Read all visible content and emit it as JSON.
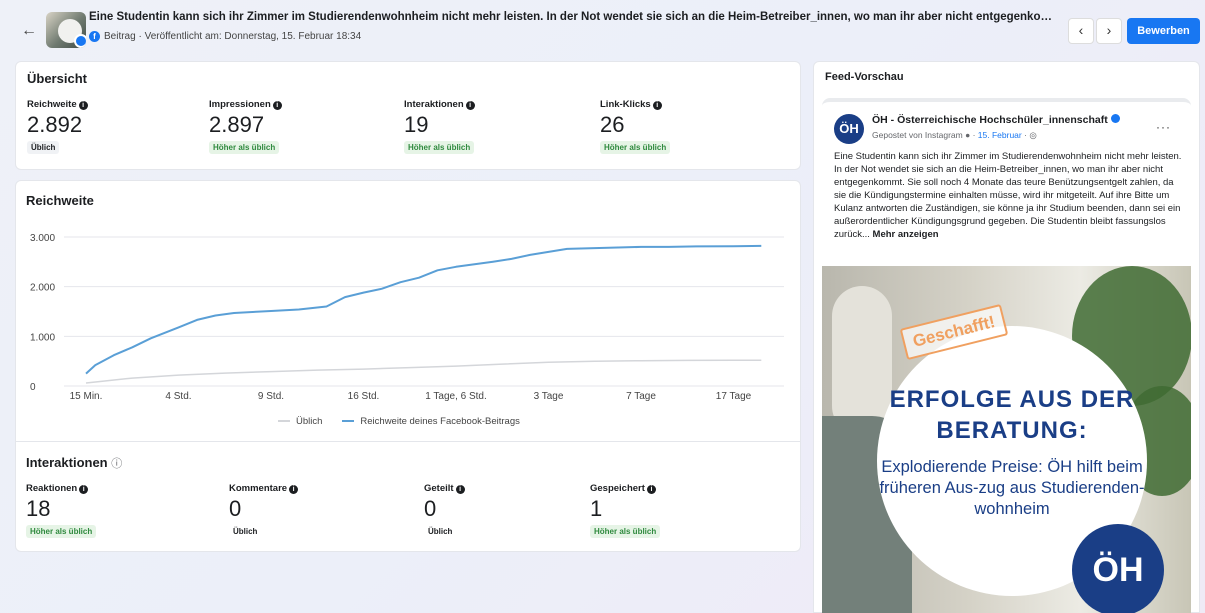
{
  "header": {
    "back_icon": "arrow-left-icon",
    "title": "Eine Studentin kann sich ihr Zimmer im Studierendenwohnheim nicht mehr leisten. In der Not wendet sie sich an die Heim-Betreiber_innen, wo man ihr aber nicht entgegenkom...",
    "subtitle": "Beitrag · Veröffentlicht am: Donnerstag, 15. Februar 18:34",
    "prev_label": "‹",
    "next_label": "›",
    "promote_label": "Bewerben"
  },
  "overview": {
    "title": "Übersicht",
    "metrics": [
      {
        "label": "Reichweite",
        "value": "2.892",
        "badge": "Üblich",
        "status": "normal"
      },
      {
        "label": "Impressionen",
        "value": "2.897",
        "badge": "Höher als üblich",
        "status": "high"
      },
      {
        "label": "Interaktionen",
        "value": "19",
        "badge": "Höher als üblich",
        "status": "high"
      },
      {
        "label": "Link-Klicks",
        "value": "26",
        "badge": "Höher als üblich",
        "status": "high"
      }
    ]
  },
  "reach_chart": {
    "title": "Reichweite",
    "legend": {
      "usual": "Üblich",
      "post": "Reichweite deines Facebook-Beitrags"
    }
  },
  "chart_data": {
    "type": "line",
    "title": "Reichweite",
    "categories": [
      "15 Min.",
      "4 Std.",
      "9 Std.",
      "16 Std.",
      "1 Tage, 6 Std.",
      "3 Tage",
      "7 Tage",
      "17 Tage"
    ],
    "yticks": [
      "3.000",
      "2.000",
      "1.000",
      "0"
    ],
    "ylim": [
      0,
      3000
    ],
    "grid": true,
    "legend_position": "bottom",
    "series": [
      {
        "name": "Reichweite deines Facebook-Beitrags",
        "color": "#5a9fd6",
        "x": [
          0,
          0.1,
          0.3,
          0.5,
          0.7,
          1,
          1.2,
          1.4,
          1.6,
          1.8,
          2,
          2.3,
          2.6,
          2.8,
          3,
          3.2,
          3.4,
          3.6,
          3.8,
          4,
          4.2,
          4.4,
          4.6,
          4.8,
          5,
          5.2,
          5.4,
          5.6,
          5.8,
          6,
          6.3,
          6.6,
          7,
          7.3
        ],
        "values": [
          250,
          420,
          620,
          780,
          960,
          1180,
          1330,
          1420,
          1470,
          1490,
          1510,
          1540,
          1600,
          1790,
          1880,
          1960,
          2090,
          2180,
          2330,
          2400,
          2450,
          2500,
          2560,
          2640,
          2700,
          2760,
          2770,
          2780,
          2790,
          2800,
          2800,
          2810,
          2815,
          2820
        ]
      },
      {
        "name": "Üblich",
        "color": "#d4d6da",
        "x": [
          0,
          0.5,
          1,
          1.5,
          2,
          2.5,
          3,
          3.5,
          4,
          4.5,
          5,
          5.5,
          6,
          6.5,
          7,
          7.3
        ],
        "values": [
          60,
          160,
          220,
          260,
          290,
          320,
          340,
          370,
          400,
          440,
          480,
          500,
          510,
          515,
          520,
          520
        ]
      }
    ]
  },
  "interactions": {
    "title": "Interaktionen",
    "metrics": [
      {
        "label": "Reaktionen",
        "value": "18",
        "badge": "Höher als üblich",
        "status": "high"
      },
      {
        "label": "Kommentare",
        "value": "0",
        "badge": "Üblich",
        "status": "normal"
      },
      {
        "label": "Geteilt",
        "value": "0",
        "badge": "Üblich",
        "status": "normal"
      },
      {
        "label": "Gespeichert",
        "value": "1",
        "badge": "Höher als üblich",
        "status": "high"
      }
    ]
  },
  "feed_preview": {
    "title": "Feed-Vorschau",
    "page_name": "ÖH - Österreichische Hochschüler_innenschaft",
    "avatar_text": "ÖH",
    "meta_prefix": "Gepostet von Instagram",
    "meta_date": "15. Februar",
    "more_label": "···",
    "text": "Eine Studentin kann sich ihr Zimmer im Studierendenwohnheim nicht mehr leisten. In der Not wendet sie sich an die Heim-Betreiber_innen, wo man ihr aber nicht entgegenkommt. Sie soll noch 4 Monate das teure Benützungsentgelt zahlen, da sie die Kündigungstermine einhalten müsse, wird ihr mitgeteilt. Auf ihre Bitte um Kulanz antworten die Zuständigen, sie könne ja ihr Studium beenden, dann sei ein außerordentlicher Kündigungsgrund gegeben. Die Studentin bleibt fassungslos zurück...",
    "show_more": "Mehr anzeigen",
    "image": {
      "stamp": "Geschafft!",
      "headline": "ERFOLGE AUS DER BERATUNG:",
      "subline": "Explodierende Preise: ÖH hilft beim früheren Aus-zug aus Studierenden-wohnheim",
      "logo_text": "ÖH"
    }
  },
  "colors": {
    "accent": "#1877f2",
    "series_post": "#5a9fd6",
    "series_usual": "#d4d6da",
    "badge_high_bg": "#e6f4e6",
    "badge_high_text": "#2f8a3e",
    "brand": "#1a3e86"
  }
}
